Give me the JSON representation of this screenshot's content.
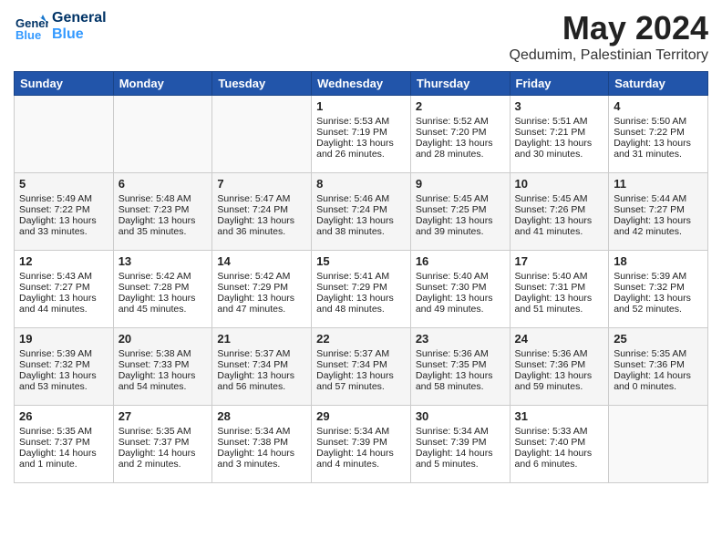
{
  "header": {
    "logo_general": "General",
    "logo_blue": "Blue",
    "month_year": "May 2024",
    "location": "Qedumim, Palestinian Territory"
  },
  "days_of_week": [
    "Sunday",
    "Monday",
    "Tuesday",
    "Wednesday",
    "Thursday",
    "Friday",
    "Saturday"
  ],
  "weeks": [
    [
      {
        "day": "",
        "data": ""
      },
      {
        "day": "",
        "data": ""
      },
      {
        "day": "",
        "data": ""
      },
      {
        "day": "1",
        "data": "Sunrise: 5:53 AM\nSunset: 7:19 PM\nDaylight: 13 hours\nand 26 minutes."
      },
      {
        "day": "2",
        "data": "Sunrise: 5:52 AM\nSunset: 7:20 PM\nDaylight: 13 hours\nand 28 minutes."
      },
      {
        "day": "3",
        "data": "Sunrise: 5:51 AM\nSunset: 7:21 PM\nDaylight: 13 hours\nand 30 minutes."
      },
      {
        "day": "4",
        "data": "Sunrise: 5:50 AM\nSunset: 7:22 PM\nDaylight: 13 hours\nand 31 minutes."
      }
    ],
    [
      {
        "day": "5",
        "data": "Sunrise: 5:49 AM\nSunset: 7:22 PM\nDaylight: 13 hours\nand 33 minutes."
      },
      {
        "day": "6",
        "data": "Sunrise: 5:48 AM\nSunset: 7:23 PM\nDaylight: 13 hours\nand 35 minutes."
      },
      {
        "day": "7",
        "data": "Sunrise: 5:47 AM\nSunset: 7:24 PM\nDaylight: 13 hours\nand 36 minutes."
      },
      {
        "day": "8",
        "data": "Sunrise: 5:46 AM\nSunset: 7:24 PM\nDaylight: 13 hours\nand 38 minutes."
      },
      {
        "day": "9",
        "data": "Sunrise: 5:45 AM\nSunset: 7:25 PM\nDaylight: 13 hours\nand 39 minutes."
      },
      {
        "day": "10",
        "data": "Sunrise: 5:45 AM\nSunset: 7:26 PM\nDaylight: 13 hours\nand 41 minutes."
      },
      {
        "day": "11",
        "data": "Sunrise: 5:44 AM\nSunset: 7:27 PM\nDaylight: 13 hours\nand 42 minutes."
      }
    ],
    [
      {
        "day": "12",
        "data": "Sunrise: 5:43 AM\nSunset: 7:27 PM\nDaylight: 13 hours\nand 44 minutes."
      },
      {
        "day": "13",
        "data": "Sunrise: 5:42 AM\nSunset: 7:28 PM\nDaylight: 13 hours\nand 45 minutes."
      },
      {
        "day": "14",
        "data": "Sunrise: 5:42 AM\nSunset: 7:29 PM\nDaylight: 13 hours\nand 47 minutes."
      },
      {
        "day": "15",
        "data": "Sunrise: 5:41 AM\nSunset: 7:29 PM\nDaylight: 13 hours\nand 48 minutes."
      },
      {
        "day": "16",
        "data": "Sunrise: 5:40 AM\nSunset: 7:30 PM\nDaylight: 13 hours\nand 49 minutes."
      },
      {
        "day": "17",
        "data": "Sunrise: 5:40 AM\nSunset: 7:31 PM\nDaylight: 13 hours\nand 51 minutes."
      },
      {
        "day": "18",
        "data": "Sunrise: 5:39 AM\nSunset: 7:32 PM\nDaylight: 13 hours\nand 52 minutes."
      }
    ],
    [
      {
        "day": "19",
        "data": "Sunrise: 5:39 AM\nSunset: 7:32 PM\nDaylight: 13 hours\nand 53 minutes."
      },
      {
        "day": "20",
        "data": "Sunrise: 5:38 AM\nSunset: 7:33 PM\nDaylight: 13 hours\nand 54 minutes."
      },
      {
        "day": "21",
        "data": "Sunrise: 5:37 AM\nSunset: 7:34 PM\nDaylight: 13 hours\nand 56 minutes."
      },
      {
        "day": "22",
        "data": "Sunrise: 5:37 AM\nSunset: 7:34 PM\nDaylight: 13 hours\nand 57 minutes."
      },
      {
        "day": "23",
        "data": "Sunrise: 5:36 AM\nSunset: 7:35 PM\nDaylight: 13 hours\nand 58 minutes."
      },
      {
        "day": "24",
        "data": "Sunrise: 5:36 AM\nSunset: 7:36 PM\nDaylight: 13 hours\nand 59 minutes."
      },
      {
        "day": "25",
        "data": "Sunrise: 5:35 AM\nSunset: 7:36 PM\nDaylight: 14 hours\nand 0 minutes."
      }
    ],
    [
      {
        "day": "26",
        "data": "Sunrise: 5:35 AM\nSunset: 7:37 PM\nDaylight: 14 hours\nand 1 minute."
      },
      {
        "day": "27",
        "data": "Sunrise: 5:35 AM\nSunset: 7:37 PM\nDaylight: 14 hours\nand 2 minutes."
      },
      {
        "day": "28",
        "data": "Sunrise: 5:34 AM\nSunset: 7:38 PM\nDaylight: 14 hours\nand 3 minutes."
      },
      {
        "day": "29",
        "data": "Sunrise: 5:34 AM\nSunset: 7:39 PM\nDaylight: 14 hours\nand 4 minutes."
      },
      {
        "day": "30",
        "data": "Sunrise: 5:34 AM\nSunset: 7:39 PM\nDaylight: 14 hours\nand 5 minutes."
      },
      {
        "day": "31",
        "data": "Sunrise: 5:33 AM\nSunset: 7:40 PM\nDaylight: 14 hours\nand 6 minutes."
      },
      {
        "day": "",
        "data": ""
      }
    ]
  ]
}
